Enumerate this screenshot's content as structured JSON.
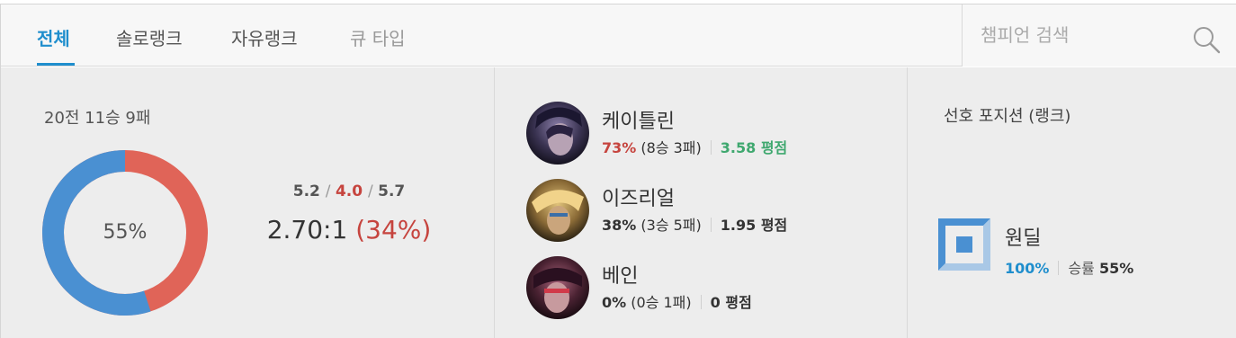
{
  "tabs": [
    {
      "label": "전체",
      "state": "active"
    },
    {
      "label": "솔로랭크",
      "state": "normal"
    },
    {
      "label": "자유랭크",
      "state": "normal"
    },
    {
      "label": "큐 타입",
      "state": "disabled"
    }
  ],
  "search": {
    "placeholder": "챔피언 검색",
    "icon": "search-icon"
  },
  "summary": {
    "record": "20전 11승 9패",
    "win_rate": "55%",
    "win_fraction": 0.55,
    "kda": {
      "kills": "5.2",
      "deaths": "4.0",
      "assists": "5.7"
    },
    "ratio": "2.70:1",
    "kill_participation": "(34%)"
  },
  "champions": [
    {
      "name": "케이틀린",
      "win_rate": "73%",
      "record": "(8승 3패)",
      "kda": "3.58 평점"
    },
    {
      "name": "이즈리얼",
      "win_rate": "38%",
      "record": "(3승 5패)",
      "kda": "1.95 평점"
    },
    {
      "name": "베인",
      "win_rate": "0%",
      "record": "(0승 1패)",
      "kda": "0 평점"
    }
  ],
  "positions": {
    "title": "선호 포지션 (랭크)",
    "items": [
      {
        "name": "원딜",
        "role_rate": "100%",
        "win_label": "승률",
        "win_rate": "55%",
        "icon": "adc-position-icon"
      }
    ]
  },
  "colors": {
    "accent": "#1f8ecd",
    "donut_win": "#4a90d2",
    "donut_loss": "#e06458",
    "loss_text": "#c6443e",
    "kda_good": "#3fa86f"
  }
}
